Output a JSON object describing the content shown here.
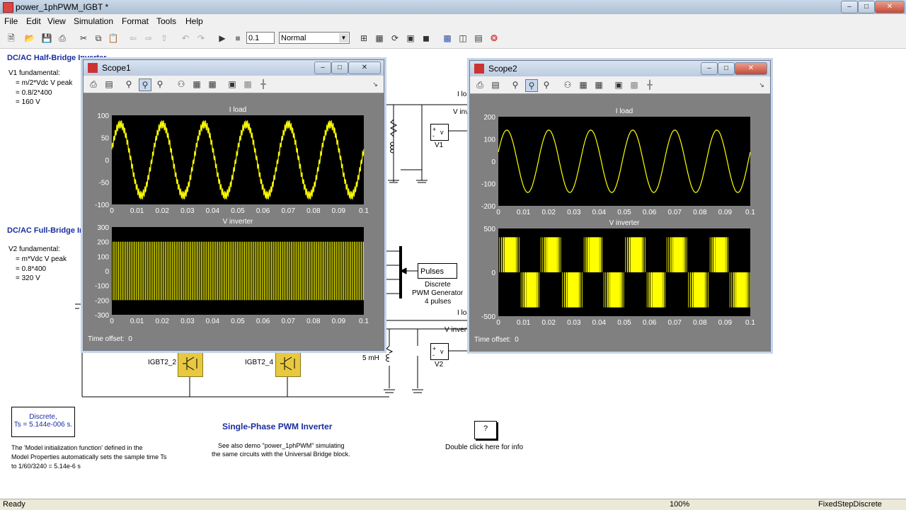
{
  "window": {
    "title": "power_1phPWM_IGBT *"
  },
  "menu": [
    "File",
    "Edit",
    "View",
    "Simulation",
    "Format",
    "Tools",
    "Help"
  ],
  "toolbar": {
    "stop_time": "0.1",
    "mode": "Normal"
  },
  "status": {
    "left": "Ready",
    "zoom": "100%",
    "solver": "FixedStepDiscrete"
  },
  "canvas": {
    "half_bridge_title": "DC/AC Half-Bridge Inverter",
    "v1_lines": [
      "V1 fundamental:",
      "= m/2*Vdc V peak",
      "= 0.8/2*400",
      "= 160 V"
    ],
    "full_bridge_title": "DC/AC Full-Bridge Inverter",
    "v2_lines": [
      "V2 fundamental:",
      "= m*Vdc V peak",
      "= 0.8*400",
      "= 320 V"
    ],
    "iload1": "I load",
    "vinv1": "V inver",
    "v1_label": "V1",
    "pulses": "Pulses",
    "pwm_gen": [
      "Discrete",
      "PWM Generator",
      "4 pulses"
    ],
    "iload2": "I loa",
    "vinv2": "V invert",
    "v2_label": "V2",
    "inductor": "5 mH",
    "igbt2": "IGBT2_2",
    "igbt4": "IGBT2_4",
    "discrete_block": [
      "Discrete,",
      "Ts = 5.144e-006 s."
    ],
    "init_text": [
      "The 'Model  initialization function' defined in the",
      "Model Properties automatically sets the sample time Ts",
      "to 1/60/3240 = 5.14e-6 s"
    ],
    "main_title": "Single-Phase PWM Inverter",
    "see_also": [
      "See also demo \"power_1phPWM\" simulating",
      "the same circuits with the Universal Bridge block."
    ],
    "info_q": "?",
    "info_text": "Double click here for info"
  },
  "scope1": {
    "title": "Scope1",
    "time_offset_label": "Time offset:",
    "time_offset": "0"
  },
  "scope2": {
    "title": "Scope2",
    "time_offset_label": "Time offset:",
    "time_offset": "0"
  },
  "chart_data": [
    {
      "type": "line",
      "title": "I load",
      "window": "Scope1",
      "x_ticks": [
        "0",
        "0.01",
        "0.02",
        "0.03",
        "0.04",
        "0.05",
        "0.06",
        "0.07",
        "0.08",
        "0.09",
        "0.1"
      ],
      "y_ticks": [
        "100",
        "50",
        "0",
        "-50",
        "-100"
      ],
      "xlim": [
        0,
        0.1
      ],
      "ylim": [
        -100,
        100
      ],
      "series": [
        {
          "frequency_hz": 60,
          "amplitude": 80,
          "ripple": true
        }
      ],
      "color": "#ffff00"
    },
    {
      "type": "line",
      "title": "V inverter",
      "window": "Scope1",
      "x_ticks": [
        "0",
        "0.01",
        "0.02",
        "0.03",
        "0.04",
        "0.05",
        "0.06",
        "0.07",
        "0.08",
        "0.09",
        "0.1"
      ],
      "y_ticks": [
        "300",
        "200",
        "100",
        "0",
        "-100",
        "-200",
        "-300"
      ],
      "xlim": [
        0,
        0.1
      ],
      "ylim": [
        -300,
        300
      ],
      "series": [
        {
          "levels": [
            200,
            -200
          ],
          "pwm": true
        }
      ],
      "color": "#ffff00"
    },
    {
      "type": "line",
      "title": "I load",
      "window": "Scope2",
      "x_ticks": [
        "0",
        "0.01",
        "0.02",
        "0.03",
        "0.04",
        "0.05",
        "0.06",
        "0.07",
        "0.08",
        "0.09",
        "0.1"
      ],
      "y_ticks": [
        "200",
        "100",
        "0",
        "-100",
        "-200"
      ],
      "xlim": [
        0,
        0.1
      ],
      "ylim": [
        -200,
        200
      ],
      "series": [
        {
          "frequency_hz": 60,
          "amplitude": 140
        }
      ],
      "color": "#ffff00"
    },
    {
      "type": "line",
      "title": "V inverter",
      "window": "Scope2",
      "x_ticks": [
        "0",
        "0.01",
        "0.02",
        "0.03",
        "0.04",
        "0.05",
        "0.06",
        "0.07",
        "0.08",
        "0.09",
        "0.1"
      ],
      "y_ticks": [
        "500",
        "0",
        "-500"
      ],
      "xlim": [
        0,
        0.1
      ],
      "ylim": [
        -500,
        500
      ],
      "series": [
        {
          "levels": [
            400,
            0,
            -400
          ],
          "pwm": true,
          "frequency_hz": 60
        }
      ],
      "color": "#ffff00"
    }
  ]
}
